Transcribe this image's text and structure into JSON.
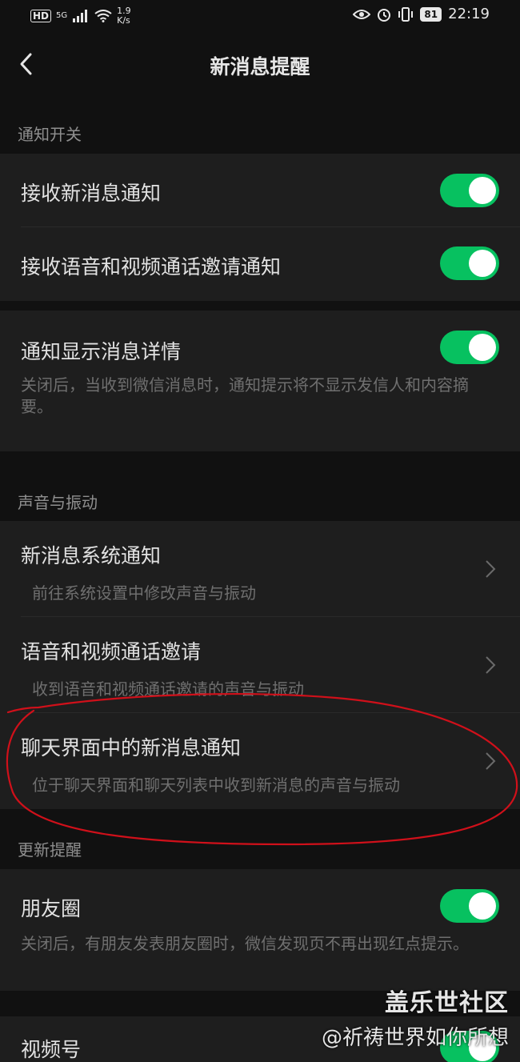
{
  "status_bar": {
    "hd": "HD",
    "network": "5G",
    "speed_value": "1.9",
    "speed_unit": "K/s",
    "battery": "81",
    "time": "22:19"
  },
  "nav": {
    "title": "新消息提醒"
  },
  "sections": {
    "notify_switch_header": "通知开关",
    "sound_header": "声音与振动",
    "update_header": "更新提醒"
  },
  "rows": {
    "receive_new": {
      "title": "接收新消息通知",
      "enabled": true
    },
    "receive_call": {
      "title": "接收语音和视频通话邀请通知",
      "enabled": true
    },
    "show_detail": {
      "title": "通知显示消息详情",
      "desc": "关闭后，当收到微信消息时，通知提示将不显示发信人和内容摘要。",
      "enabled": true
    },
    "system_notify": {
      "title": "新消息系统通知",
      "sub": "前往系统设置中修改声音与振动"
    },
    "call_invite": {
      "title": "语音和视频通话邀请",
      "sub": "收到语音和视频通话邀请的声音与振动"
    },
    "chat_notify": {
      "title": "聊天界面中的新消息通知",
      "sub": "位于聊天界面和聊天列表中收到新消息的声音与振动"
    },
    "moments": {
      "title": "朋友圈",
      "desc": "关闭后，有朋友发表朋友圈时，微信发现页不再出现红点提示。",
      "enabled": true
    },
    "channels": {
      "title": "视频号",
      "enabled": true
    }
  },
  "watermark": {
    "site": "盖乐世社区",
    "user": "@祈祷世界如你所想"
  },
  "colors": {
    "toggle_on": "#07c160",
    "annotation": "#d0101a"
  }
}
